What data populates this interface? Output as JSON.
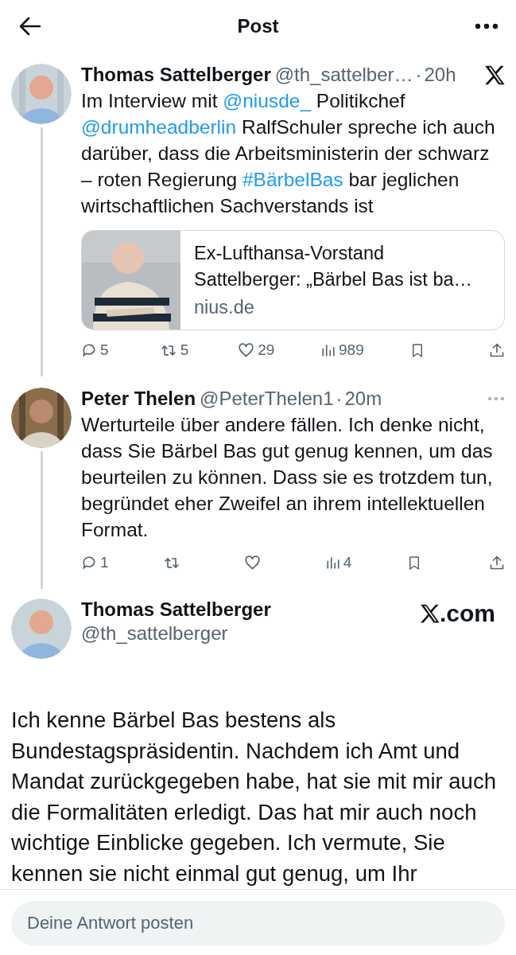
{
  "header": {
    "title": "Post"
  },
  "posts": [
    {
      "name": "Thomas Sattelberger",
      "handle": "@th_sattelber…",
      "separator": "·",
      "time": "20h",
      "corner": {
        "kind": "x-logo"
      },
      "thread_line": true,
      "text": [
        {
          "kind": "text",
          "t": "Im Interview mit "
        },
        {
          "kind": "link",
          "t": "@niusde_"
        },
        {
          "kind": "text",
          "t": " Politikchef "
        },
        {
          "kind": "link",
          "t": "@drumheadberlin"
        },
        {
          "kind": "text",
          "t": " RalfSchuler spreche ich auch darüber, dass die Arbeitsministerin der schwarz – roten Regierung "
        },
        {
          "kind": "link",
          "t": "#BärbelBas"
        },
        {
          "kind": "text",
          "t": " bar jeglichen wirtschaftlichen Sachverstands ist"
        }
      ],
      "card": {
        "title": "Ex-Lufthansa-Vorstand Sattelberger: „Bärbel Bas ist ba…",
        "domain": "nius.de"
      },
      "actions": [
        {
          "kind": "reply",
          "count": "5"
        },
        {
          "kind": "repost",
          "count": "5"
        },
        {
          "kind": "like",
          "count": "29"
        },
        {
          "kind": "views",
          "count": "989"
        },
        {
          "kind": "bookmark"
        },
        {
          "kind": "share"
        }
      ]
    },
    {
      "name": "Peter Thelen",
      "handle": "@PeterThelen1",
      "separator": "·",
      "time": "20m",
      "corner": {
        "kind": "more"
      },
      "thread_line": true,
      "text": [
        {
          "kind": "text",
          "t": "Werturteile über andere fällen. Ich denke nicht, dass Sie Bärbel Bas gut genug kennen, um das beurteilen zu können. Dass sie es trotzdem tun, begründet eher Zweifel an ihrem intellektuellen Format."
        }
      ],
      "actions": [
        {
          "kind": "reply",
          "count": "1"
        },
        {
          "kind": "repost"
        },
        {
          "kind": "like"
        },
        {
          "kind": "views",
          "count": "4"
        },
        {
          "kind": "bookmark"
        },
        {
          "kind": "share"
        }
      ]
    }
  ],
  "quoted": {
    "name": "Thomas Sattelberger",
    "handle": "@th_sattelberger",
    "brand": ".com",
    "body": "Ich kenne Bärbel Bas bestens als Bundestagspräsidentin. Nachdem ich Amt und Mandat zurückgegeben habe, hat sie mit mir auch die Formalitäten erledigt. Das hat mir auch noch wichtige Einblicke  gegeben. Ich vermute, Sie kennen sie nicht einmal gut genug, um Ihr"
  },
  "reply": {
    "placeholder": "Deine Antwort posten"
  }
}
